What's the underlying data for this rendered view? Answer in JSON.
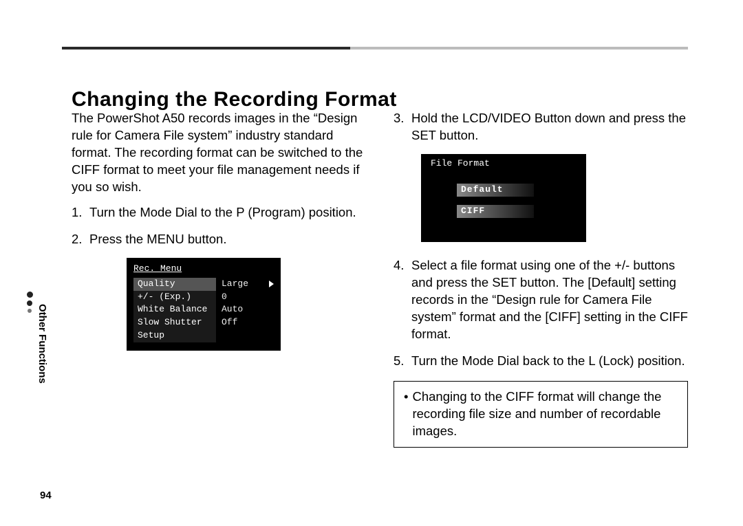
{
  "side_label": "Other Functions",
  "page_number": "94",
  "heading": "Changing the Recording Format",
  "intro": "The PowerShot A50 records images in the “Design rule for Camera File system” industry standard format. The recording format can be switched to the CIFF format to meet your file management needs if you so wish.",
  "steps": {
    "1": "Turn the Mode Dial to the P (Program) position.",
    "2": "Press the MENU button.",
    "3": "Hold the LCD/VIDEO Button down and press the SET button.",
    "4": "Select a file format using one of the +/- buttons and press the SET button. The [Default] setting records in the “Design rule for Camera File system” format and the [CIFF] setting in the CIFF format.",
    "5": "Turn the Mode Dial back to the L (Lock) position."
  },
  "note": "Changing to the CIFF format will change the recording file size and number of recordable images.",
  "screenshot1": {
    "title": "Rec. Menu",
    "rows": [
      {
        "label": "Quality",
        "value": "Large",
        "highlight": true,
        "arrow": true
      },
      {
        "label": "+/- (Exp.)",
        "value": "0"
      },
      {
        "label": "White Balance",
        "value": "Auto"
      },
      {
        "label": "Slow Shutter",
        "value": "Off"
      },
      {
        "label": "Setup",
        "value": ""
      }
    ]
  },
  "screenshot2": {
    "title": "File Format",
    "options": [
      "Default",
      "CIFF"
    ]
  }
}
